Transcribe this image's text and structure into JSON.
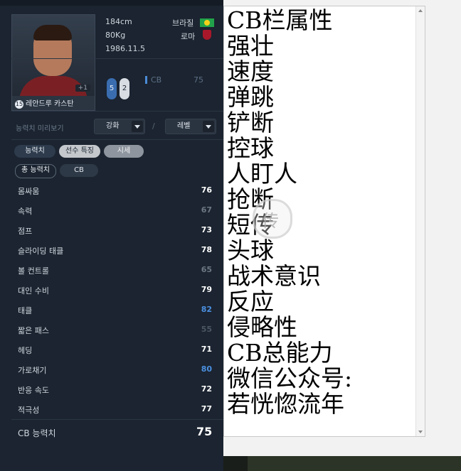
{
  "player": {
    "height": "184cm",
    "weight": "80Kg",
    "birth": "1986.11.5",
    "nation": "브라질",
    "club": "로마",
    "name": "레안드루 카스탄",
    "season_badge": "15",
    "plus": "+1",
    "feet": {
      "left": "5",
      "right": "2"
    },
    "position": "CB",
    "position_ovr": "75"
  },
  "preview": {
    "label": "능력치 미리보기",
    "enhance": "강화",
    "level": "레벨",
    "slash": "/"
  },
  "tabs": [
    "능력치",
    "선수 특징",
    "시세"
  ],
  "subtabs": [
    "총 능력치",
    "CB"
  ],
  "stats": [
    {
      "label": "몸싸움",
      "value": "76",
      "color": "#ffffff"
    },
    {
      "label": "속력",
      "value": "67",
      "color": "#6d7784"
    },
    {
      "label": "점프",
      "value": "73",
      "color": "#ffffff"
    },
    {
      "label": "슬라이딩 태클",
      "value": "78",
      "color": "#ffffff"
    },
    {
      "label": "볼 컨트롤",
      "value": "65",
      "color": "#6d7784"
    },
    {
      "label": "대인 수비",
      "value": "79",
      "color": "#ffffff"
    },
    {
      "label": "태클",
      "value": "82",
      "color": "#4b8fe0"
    },
    {
      "label": "짧은 패스",
      "value": "55",
      "color": "#4b5563"
    },
    {
      "label": "헤딩",
      "value": "71",
      "color": "#ffffff"
    },
    {
      "label": "가로채기",
      "value": "80",
      "color": "#4b8fe0"
    },
    {
      "label": "반응 속도",
      "value": "72",
      "color": "#ffffff"
    },
    {
      "label": "적극성",
      "value": "77",
      "color": "#ffffff"
    }
  ],
  "total": {
    "label": "CB 능력치",
    "value": "75"
  },
  "doc_lines": [
    "CB栏属性",
    "强壮",
    "速度",
    "弹跳",
    "铲断",
    "控球",
    "人盯人",
    "抢断",
    "短传",
    "头球",
    "战术意识",
    "反应",
    "侵略性",
    "CB总能力",
    "微信公众号:",
    "若恍惚流年"
  ],
  "colors": {
    "panel": "#1b2430",
    "accent": "#4b8fe0",
    "tab_active": "#2d3b4c",
    "tab_inactive": "#8e959e"
  }
}
